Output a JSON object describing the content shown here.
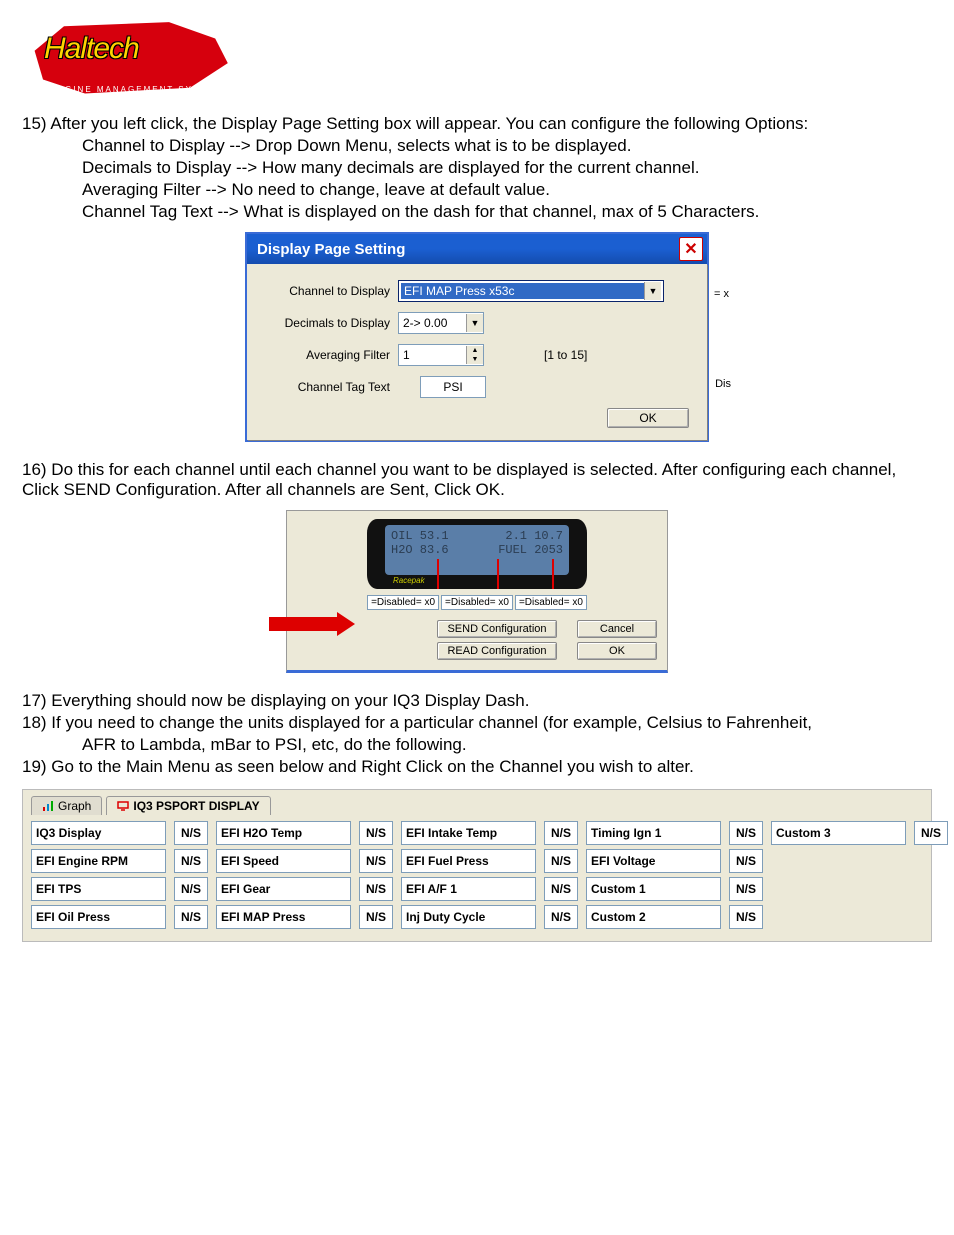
{
  "logo": {
    "main": "Haltech",
    "sub": "ENGINE MANAGEMENT SYSTEMS"
  },
  "steps": {
    "s15": "15) After you left click, the Display Page Setting box will appear.  You can configure the following Options:",
    "s15a": "Channel to Display --> Drop Down Menu, selects what is to be displayed.",
    "s15b": "Decimals to Display --> How many decimals are displayed for the current channel.",
    "s15c": "Averaging Filter --> No need to change, leave at default value.",
    "s15d": "Channel Tag Text --> What is displayed on the dash for that channel, max of 5 Characters.",
    "s16": "16) Do this for each channel until each channel you want to be displayed is selected.  After configuring each channel, Click SEND Configuration.  After all channels are Sent, Click OK.",
    "s17": "17) Everything should now be displaying on your IQ3 Display Dash.",
    "s18": "18) If you need to change the units displayed for a particular channel (for example, Celsius to Fahrenheit, AFR to Lambda, mBar to PSI, etc, do the following.",
    "s18a": "AFR to Lambda, mBar to PSI, etc, do the following.",
    "s19": "19) Go to the Main Menu as seen below and Right Click on the Channel you wish to alter."
  },
  "dialog1": {
    "title": "Display Page Setting",
    "labels": {
      "channel": "Channel to Display",
      "decimals": "Decimals to Display",
      "avg": "Averaging Filter",
      "tag": "Channel Tag Text"
    },
    "values": {
      "channel": "EFI MAP Press x53c",
      "decimals": "2-> 0.00",
      "avg": "1",
      "tag": "PSI"
    },
    "range": "[1 to 15]",
    "ok": "OK",
    "outside_right_top": "= x",
    "outside_right_mid": "Dis"
  },
  "dialog2": {
    "dash_brand": "Racepak",
    "dash_vals": [
      "OIL 53.1",
      "2.1 10.7",
      "H2O 83.6",
      "FUEL 2053"
    ],
    "disabled": [
      "=Disabled= x0",
      "=Disabled= x0",
      "=Disabled= x0"
    ],
    "btns": {
      "send": "SEND Configuration",
      "cancel": "Cancel",
      "read": "READ Configuration",
      "ok": "OK"
    }
  },
  "tabs": {
    "graph": "Graph",
    "display": "IQ3 PSPORT DISPLAY"
  },
  "channels": [
    [
      {
        "n": "IQ3 Display",
        "s": "N/S"
      },
      {
        "n": "EFI H2O Temp",
        "s": "N/S"
      },
      {
        "n": "EFI Intake Temp",
        "s": "N/S"
      },
      {
        "n": "Timing Ign 1",
        "s": "N/S"
      },
      {
        "n": "Custom 3",
        "s": "N/S"
      }
    ],
    [
      {
        "n": "EFI Engine RPM",
        "s": "N/S"
      },
      {
        "n": "EFI Speed",
        "s": "N/S"
      },
      {
        "n": "EFI Fuel Press",
        "s": "N/S"
      },
      {
        "n": "EFI Voltage",
        "s": "N/S"
      }
    ],
    [
      {
        "n": "EFI TPS",
        "s": "N/S"
      },
      {
        "n": "EFI Gear",
        "s": "N/S"
      },
      {
        "n": "EFI A/F 1",
        "s": "N/S"
      },
      {
        "n": "Custom 1",
        "s": "N/S"
      }
    ],
    [
      {
        "n": "EFI Oil Press",
        "s": "N/S"
      },
      {
        "n": "EFI MAP Press",
        "s": "N/S"
      },
      {
        "n": "Inj Duty Cycle",
        "s": "N/S"
      },
      {
        "n": "Custom 2",
        "s": "N/S"
      }
    ]
  ]
}
